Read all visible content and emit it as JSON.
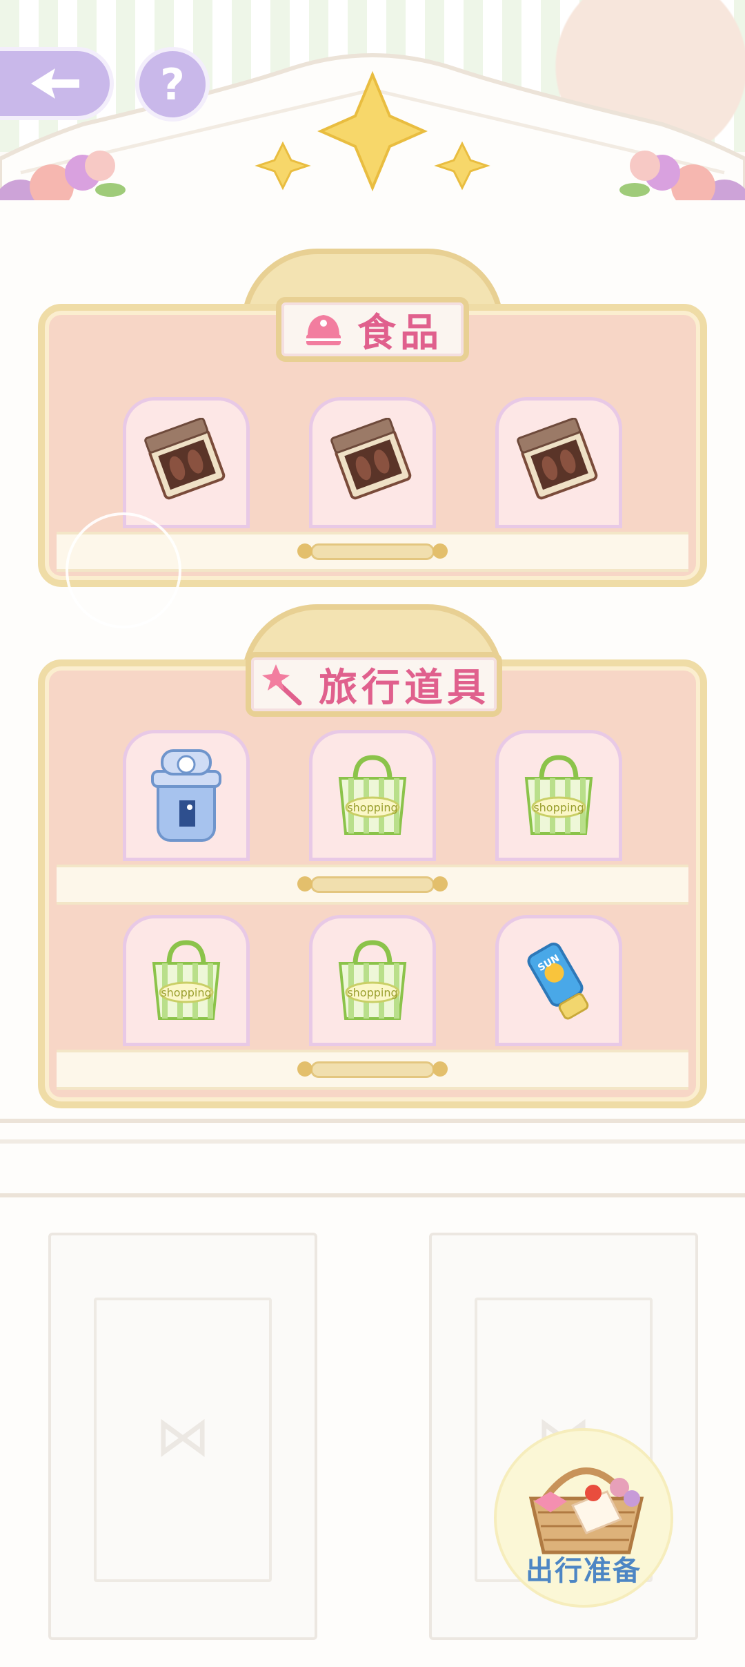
{
  "nav": {
    "back_icon": "back-arrow-icon",
    "help_label": "?"
  },
  "shelves": {
    "food": {
      "title": "食品",
      "icon": "cake-icon",
      "items": [
        {
          "icon": "chocolate-box-icon"
        },
        {
          "icon": "chocolate-box-icon"
        },
        {
          "icon": "chocolate-box-icon"
        }
      ]
    },
    "travel": {
      "title": "旅行道具",
      "icon": "magic-wand-icon",
      "items": [
        {
          "icon": "water-bottle-icon"
        },
        {
          "icon": "shopping-bag-icon",
          "label": "shopping"
        },
        {
          "icon": "shopping-bag-icon",
          "label": "shopping"
        },
        {
          "icon": "shopping-bag-icon",
          "label": "shopping"
        },
        {
          "icon": "shopping-bag-icon",
          "label": "shopping"
        },
        {
          "icon": "sunscreen-tube-icon",
          "label": "SUN"
        }
      ]
    }
  },
  "prep_button": {
    "label": "出行准备",
    "icon": "picnic-basket-icon"
  },
  "colors": {
    "panel": "#f7d6c6",
    "gold": "#efdca6",
    "title": "#e0608d",
    "nav": "#c9b8ea",
    "prep_label": "#4d86c4"
  }
}
